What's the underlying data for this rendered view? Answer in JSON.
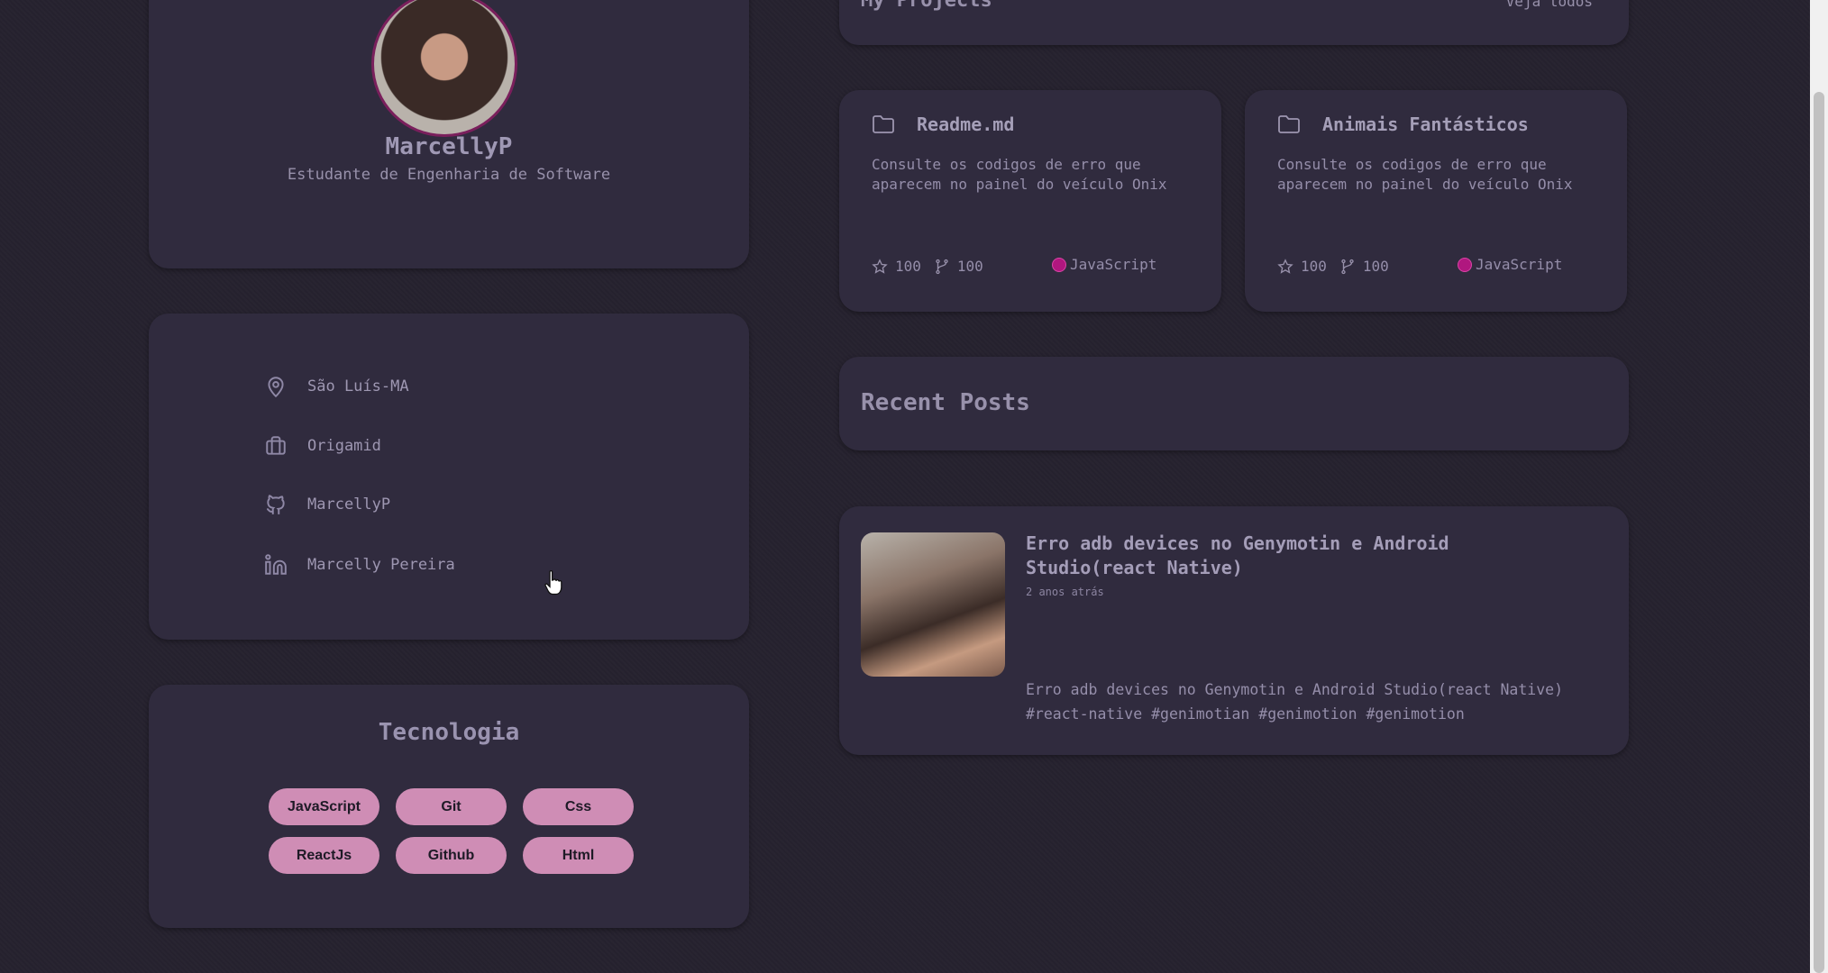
{
  "profile": {
    "name": "MarcellyP",
    "subtitle": "Estudante de Engenharia de Software"
  },
  "info": {
    "items": [
      {
        "icon": "location-pin-icon",
        "label": "São Luís-MA"
      },
      {
        "icon": "briefcase-icon",
        "label": "Origamid"
      },
      {
        "icon": "github-icon",
        "label": "MarcellyP"
      },
      {
        "icon": "linkedin-icon",
        "label": "Marcelly Pereira"
      }
    ]
  },
  "tech": {
    "title": "Tecnologia",
    "items": [
      "JavaScript",
      "Git",
      "Css",
      "ReactJs",
      "Github",
      "Html"
    ],
    "pill_color": "#cf8db5"
  },
  "projects": {
    "header_title": "My Projects",
    "header_link": "Veja todos",
    "cards": [
      {
        "title": "Readme.md",
        "description": "Consulte os codigos de erro que aparecem no painel do veículo Onix",
        "stars": "100",
        "forks": "100",
        "language": "JavaScript"
      },
      {
        "title": "Animais Fantásticos",
        "description": "Consulte os codigos de erro que aparecem no painel do veículo Onix",
        "stars": "100",
        "forks": "100",
        "language": "JavaScript"
      }
    ],
    "language_color": "#b0177f"
  },
  "recent_posts": {
    "title": "Recent Posts",
    "post": {
      "title": "Erro adb devices no Genymotin e Android Studio(react Native)",
      "time": "2 anos atrás",
      "body": "Erro adb devices no Genymotin e Android Studio(react Native) #react-native #genimotian #genimotion #genimotion"
    }
  },
  "colors": {
    "background": "#26222f",
    "card": "#302b3e",
    "avatar_ring": "#7a1f5c"
  }
}
